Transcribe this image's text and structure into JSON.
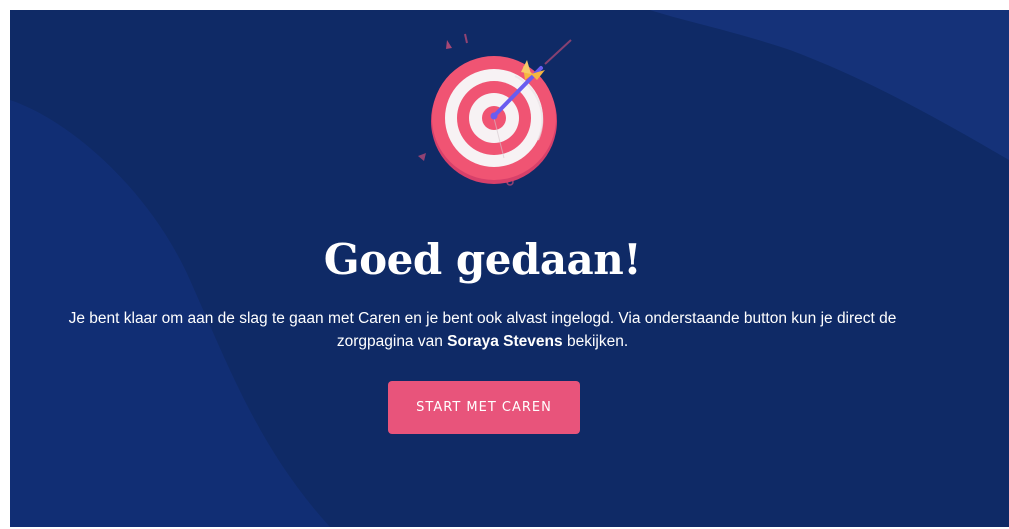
{
  "headline": "Goed gedaan!",
  "message": {
    "part1": "Je bent klaar om aan de slag te gaan met Caren en je bent ook alvast ingelogd. Via onderstaande button kun je direct de zorgpagina van ",
    "name": "Soraya Stevens",
    "part2": " bekijken."
  },
  "cta_label": "START MET CAREN",
  "colors": {
    "background": "#0f2a66",
    "wave": "#15337a",
    "button": "#e8547b",
    "target_red": "#f05473",
    "target_white": "#f7f2f4",
    "arrow_shaft": "#6a5cf0",
    "arrow_feather": "#f5b640",
    "text": "#ffffff"
  },
  "icons": {
    "illustration": "target-bullseye-with-arrow"
  }
}
